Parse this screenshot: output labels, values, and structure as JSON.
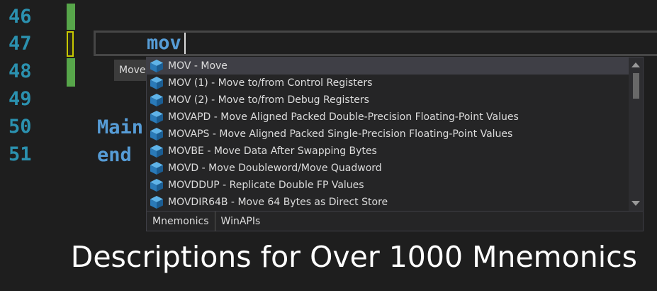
{
  "editor": {
    "line_numbers": [
      "46",
      "47",
      "48",
      "49",
      "50",
      "51"
    ],
    "typed_text": "mov",
    "code_lines": [
      "Main",
      "end"
    ],
    "colors": {
      "background": "#1e1e1e",
      "line_number": "#2b91af",
      "keyword": "#569cd6",
      "change_bar": "#57a64a",
      "change_mark": "#c8c800"
    }
  },
  "tooltip": {
    "label": "Move"
  },
  "completion": {
    "item_icon": "cube-icon",
    "items": [
      "MOV - Move",
      "MOV (1) - Move to/from Control Registers",
      "MOV (2) - Move to/from Debug Registers",
      "MOVAPD - Move Aligned Packed Double-Precision Floating-Point Values",
      "MOVAPS - Move Aligned Packed Single-Precision Floating-Point Values",
      "MOVBE - Move Data After Swapping Bytes",
      "MOVD - Move Doubleword/Move Quadword",
      "MOVDDUP - Replicate Double FP Values",
      "MOVDIR64B - Move 64 Bytes as Direct Store"
    ],
    "selected_index": 0,
    "tabs": [
      "Mnemonics",
      "WinAPIs"
    ]
  },
  "caption": "Descriptions for Over 1000 Mnemonics"
}
